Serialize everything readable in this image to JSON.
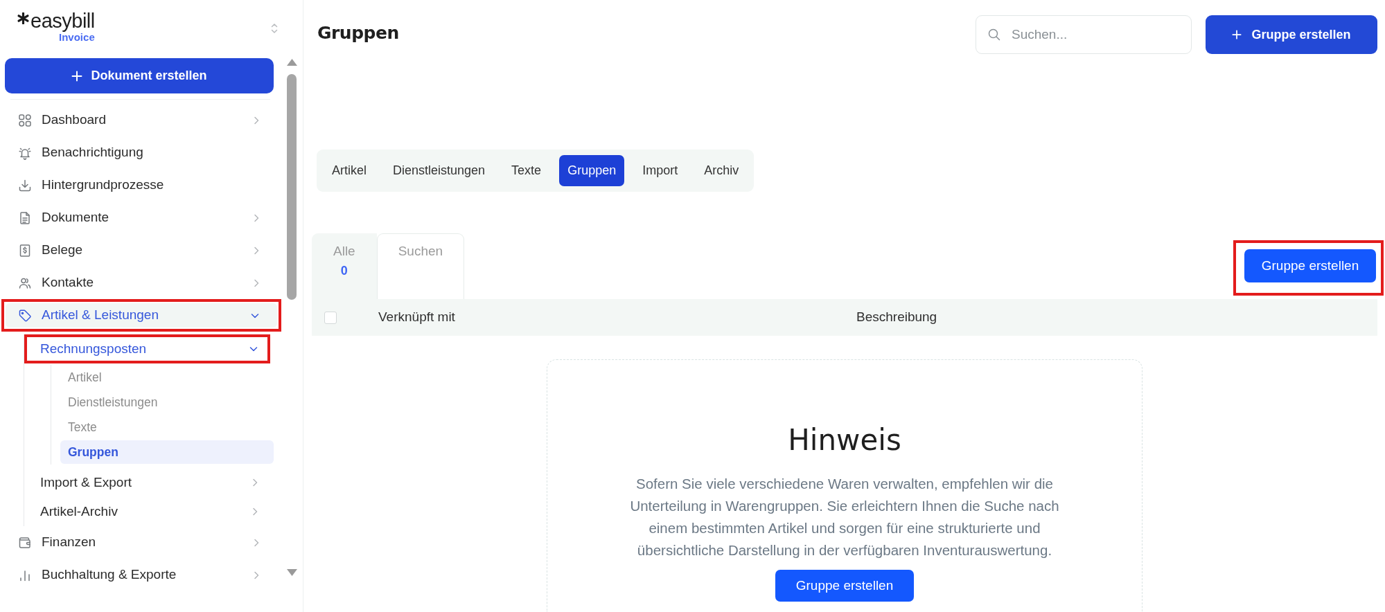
{
  "sidebar": {
    "logo": {
      "wordmark": "easybill",
      "product": "Invoice"
    },
    "create_button": {
      "label": "Dokument erstellen"
    },
    "items": [
      {
        "label": "Dashboard",
        "selected": false,
        "expanded": false,
        "highlighted": false
      },
      {
        "label": "Benachrichtigung",
        "selected": false,
        "highlighted": false
      },
      {
        "label": "Hintergrundprozesse",
        "selected": false,
        "highlighted": false
      },
      {
        "label": "Dokumente",
        "selected": false,
        "expanded": false,
        "highlighted": false
      },
      {
        "label": "Belege",
        "selected": false,
        "expanded": false,
        "highlighted": false
      },
      {
        "label": "Kontakte",
        "selected": false,
        "expanded": false,
        "highlighted": false
      },
      {
        "label": "Artikel & Leistungen",
        "selected": true,
        "expanded": true,
        "highlighted": true,
        "children": [
          {
            "label": "Rechnungsposten",
            "selected": true,
            "expanded": true,
            "highlighted": true,
            "children": [
              {
                "label": "Artikel",
                "selected": false,
                "highlighted": false
              },
              {
                "label": "Dienstleistungen",
                "selected": false,
                "highlighted": false
              },
              {
                "label": "Texte",
                "selected": false,
                "highlighted": false
              },
              {
                "label": "Gruppen",
                "selected": true,
                "highlighted": false
              }
            ]
          },
          {
            "label": "Import & Export",
            "selected": false,
            "expanded": false,
            "highlighted": false
          },
          {
            "label": "Artikel-Archiv",
            "selected": false,
            "expanded": false,
            "highlighted": false
          }
        ]
      },
      {
        "label": "Finanzen",
        "selected": false,
        "expanded": false,
        "highlighted": false
      },
      {
        "label": "Buchhaltung & Exporte",
        "selected": false,
        "expanded": false,
        "highlighted": false
      }
    ]
  },
  "header": {
    "title": "Gruppen",
    "search": {
      "placeholder": "Suchen..."
    },
    "create_button": {
      "label": "Gruppe erstellen"
    }
  },
  "tabs": [
    {
      "label": "Artikel",
      "selected": false
    },
    {
      "label": "Dienstleistungen",
      "selected": false
    },
    {
      "label": "Texte",
      "selected": false
    },
    {
      "label": "Gruppen",
      "selected": true
    },
    {
      "label": "Import",
      "selected": false
    },
    {
      "label": "Archiv",
      "selected": false
    }
  ],
  "filter_tabs": [
    {
      "label": "Alle",
      "count": "0",
      "selected": true
    },
    {
      "label": "Suchen",
      "selected": false
    }
  ],
  "toolbar_button": {
    "label": "Gruppe erstellen",
    "highlighted": true
  },
  "table": {
    "select_all": {
      "checked": false
    },
    "columns": [
      "Verknüpft mit",
      "Beschreibung"
    ]
  },
  "empty_state": {
    "title": "Hinweis",
    "text": "Sofern Sie viele verschiedene Waren verwalten, empfehlen wir die Unterteilung in Warengruppen. Sie erleichtern Ihnen die Suche nach einem bestimmten Artikel und sorgen für eine strukturierte und übersichtliche Darstellung in der verfügbaren Inventurauswertung.",
    "button": {
      "label": "Gruppe erstellen"
    }
  }
}
